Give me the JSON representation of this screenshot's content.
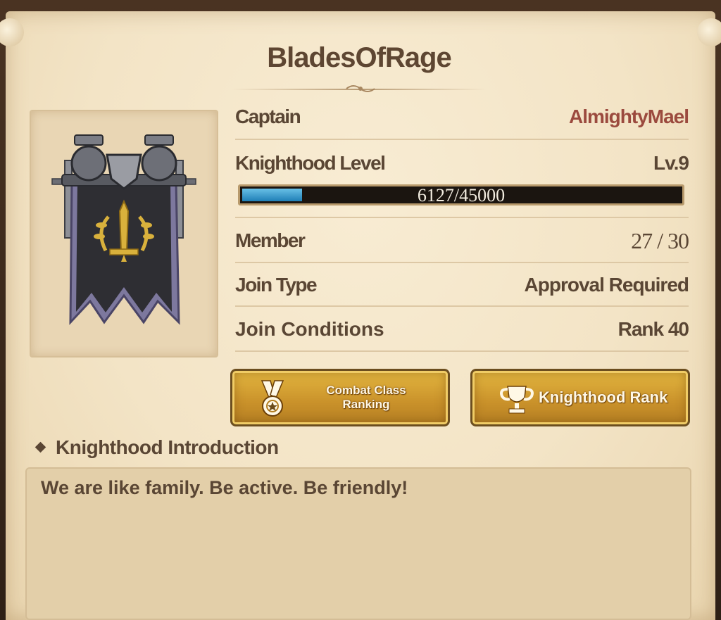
{
  "knighthood": {
    "name": "BladesOfRage",
    "emblem_icon": "knight-banner-sword-laurel"
  },
  "info": {
    "captain_label": "Captain",
    "captain_value": "AlmightyMael",
    "level_label": "Knighthood Level",
    "level_value": "Lv.9",
    "xp_text": "6127/45000",
    "xp_current": 6127,
    "xp_max": 45000,
    "member_label": "Member",
    "member_value": "27 / 30",
    "join_type_label": "Join Type",
    "join_type_value": "Approval Required",
    "join_conditions_label": "Join Conditions",
    "join_conditions_value": "Rank 40"
  },
  "buttons": {
    "combat_line1": "Combat Class",
    "combat_line2": "Ranking",
    "combat_icon": "medal-icon",
    "rank_label": "Knighthood Rank",
    "rank_icon": "trophy-icon"
  },
  "intro": {
    "heading": "Knighthood Introduction",
    "text": "We are like family. Be active. Be friendly!"
  },
  "colors": {
    "parchment": "#f3e4c6",
    "text_brown": "#5a4634",
    "captain_name": "#9b4a3e",
    "button_gold": "#d9a535",
    "xp_fill": "#2f96cc"
  }
}
